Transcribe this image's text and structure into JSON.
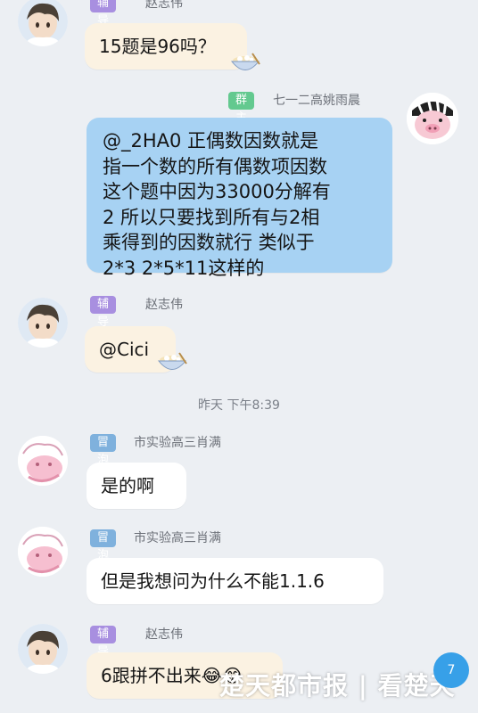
{
  "messages": [
    {
      "role": "辅导员",
      "sender": "赵志伟",
      "text": "15题是96吗？"
    },
    {
      "role": "群主",
      "sender": "七一二高姚雨晨",
      "text": "@_2HA0 正偶数因数就是指一个数的所有偶数项因数这个题中因为33000分解有2 所以只要找到所有与2相乘得到的因数就行 类似于2*3 2*5*11这样的"
    },
    {
      "role": "辅导员",
      "sender": "赵志伟",
      "text": "@Cici"
    },
    {
      "role": "冒泡",
      "sender": "市实验高三肖满",
      "text": "是的啊"
    },
    {
      "role": "冒泡",
      "sender": "市实验高三肖满",
      "text": "但是我想问为什么不能1.1.6"
    },
    {
      "role": "辅导员",
      "sender": "赵志伟",
      "text": "6跟拼不出来😂😂"
    }
  ],
  "blue_lines": [
    "@_2HA0 正偶数因数就是",
    "指一个数的所有偶数项因数",
    "这个题中因为33000分解有",
    "2 所以只要找到所有与2相",
    "乘得到的因数就行 类似于",
    "2*3 2*5*11这样的"
  ],
  "timestamp": "昨天 下午8:39",
  "watermark": "楚天都市报 | 看楚天",
  "fab_label": "7",
  "colors": {
    "background": "#eceff3",
    "tutor_badge": "#a88fe0",
    "owner_badge": "#63c98f",
    "bubble_badge": "#7fb1dd",
    "tutor_bubble": "#fbf2e2",
    "owner_bubble": "#a7d2f3",
    "member_bubble": "#ffffff"
  },
  "icons": [
    "boy-avatar-icon",
    "pig-avatar-icon",
    "pink-avatar-icon",
    "rice-bowl-icon"
  ]
}
